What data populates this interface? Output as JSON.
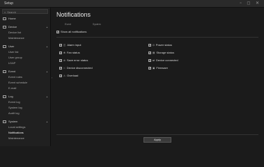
{
  "window": {
    "title": "Setup",
    "controls": "▫ ◻ ✕"
  },
  "search": {
    "placeholder": "Search"
  },
  "nav": {
    "home": "Home",
    "groups": [
      {
        "label": "Device",
        "items": [
          "Device list",
          "Maintenance"
        ]
      },
      {
        "label": "User",
        "items": [
          "User list",
          "User group",
          "LDAP"
        ]
      },
      {
        "label": "Event",
        "items": [
          "Event rules",
          "Event schedule",
          "E-mail"
        ]
      },
      {
        "label": "Log",
        "items": [
          "Event log",
          "System log",
          "Audit log"
        ]
      },
      {
        "label": "System",
        "items": [
          "Local settings",
          "Notifications",
          "Maintenance"
        ]
      }
    ],
    "active_item": "Notifications"
  },
  "main": {
    "title": "Notifications",
    "timezone_label": "Event",
    "timezone_value": "System",
    "show_all": {
      "label": "Show all notifications",
      "checked": true
    },
    "left_options": [
      {
        "label": "Alarm input",
        "checked": true
      },
      {
        "label": "Fan status",
        "checked": true
      },
      {
        "label": "Save error status",
        "checked": true
      },
      {
        "label": "Device disconnected",
        "checked": true
      },
      {
        "label": "Overload",
        "checked": true
      }
    ],
    "right_options": [
      {
        "label": "Power status",
        "checked": true
      },
      {
        "label": "Storage status",
        "checked": true
      },
      {
        "label": "Device connected",
        "checked": true
      },
      {
        "label": "Firmware",
        "checked": true
      }
    ],
    "apply_label": "Apply"
  }
}
